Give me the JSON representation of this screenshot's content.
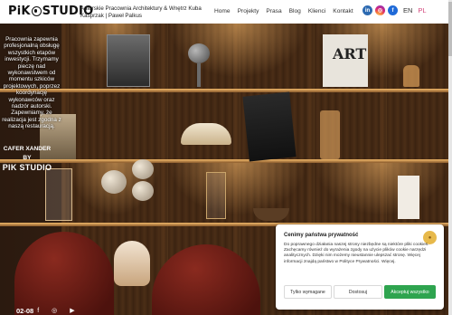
{
  "header": {
    "logo_text_left": "PiK",
    "logo_text_right": "STUDIO",
    "tagline": "Autorskie Pracownia Architektury & Wnętrz Kuba Kasprzak | Paweł Palkus",
    "nav": [
      "Home",
      "Projekty",
      "Prasa",
      "Blog",
      "Klienci",
      "Kontakt"
    ],
    "social": [
      {
        "icon": "linkedin-icon",
        "glyph": "in",
        "color": "#2d6ab1"
      },
      {
        "icon": "instagram-icon",
        "glyph": "◎",
        "color": "#d6287b"
      },
      {
        "icon": "facebook-icon",
        "glyph": "f",
        "color": "#1f6ad8"
      }
    ],
    "languages": [
      "EN",
      "PL"
    ]
  },
  "hero": {
    "description": "Pracownia zapewnia profesjonalną obsługę wszystkich etapów inwestycji. Trzymamy pieczę nad wykonawstwem od momentu szkiców projektowych, poprzez koordynację wykonawców oraz nadzór autorski. Zapewniamy, że realizacja jest zgodna z naszą restauracją.",
    "credit_line1": "CAFER XANDER",
    "credit_line2": "BY",
    "credit_line3": "PIK STUDIO"
  },
  "footer": {
    "year": "02-08",
    "icons": [
      "facebook-icon",
      "instagram-icon",
      "youtube-icon"
    ]
  },
  "cookie": {
    "title": "Cenimy państwa prywatność",
    "body": "Do poprawnego działania naszej strony niezbędne są niektóre pliki cookies. Zachęcamy również do wyrażenia zgody na użycie plików cookie narzędzi analitycznych. Dzięki nim możemy nieustannie ulepszać stronę. Więcej informacji znajdą państwo w Polityce Prywatności. Więcej.",
    "btn_deny": "Tylko wymagane",
    "btn_customize": "Dostosuj",
    "btn_accept": "Akceptuj wszystko",
    "accept_color": "#2ea44f"
  }
}
